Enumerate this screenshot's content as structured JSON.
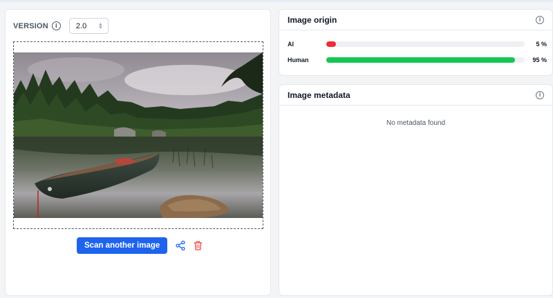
{
  "version": {
    "label": "VERSION",
    "selected": "2.0"
  },
  "actions": {
    "scan_label": "Scan another image"
  },
  "origin": {
    "title": "Image origin",
    "rows": [
      {
        "label": "AI",
        "value": "5 %",
        "percent": 5,
        "color": "#ef2b3a"
      },
      {
        "label": "Human",
        "value": "95 %",
        "percent": 95,
        "color": "#16c653"
      }
    ]
  },
  "metadata": {
    "title": "Image metadata",
    "empty_text": "No metadata found"
  },
  "colors": {
    "primary": "#1d63ed",
    "danger": "#ef4444",
    "ai_bar": "#ef2b3a",
    "human_bar": "#16c653"
  }
}
